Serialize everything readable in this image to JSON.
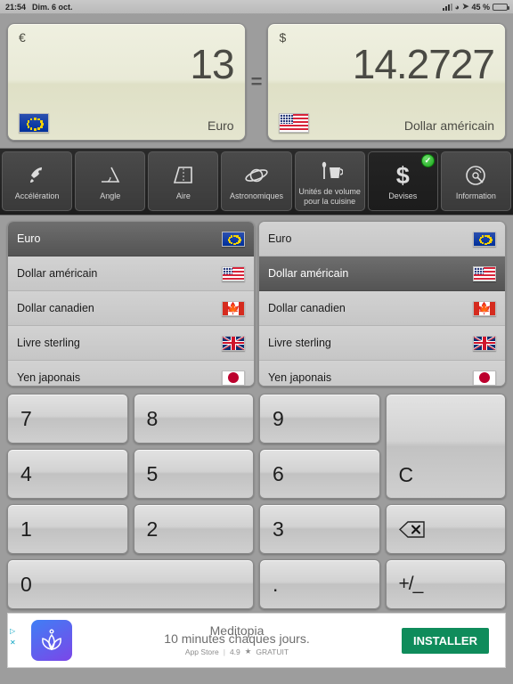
{
  "statusbar": {
    "time": "21:54",
    "date": "Dim. 6 oct.",
    "battery_percent": "45 %",
    "icons": [
      "signal-icon",
      "wifi-icon",
      "location-arrow-icon",
      "battery-icon"
    ]
  },
  "displays": {
    "left": {
      "symbol": "€",
      "value": "13",
      "currency_name": "Euro",
      "flag": "flag-eu"
    },
    "equals": "=",
    "right": {
      "symbol": "$",
      "value": "14.2727",
      "currency_name": "Dollar américain",
      "flag": "flag-us"
    }
  },
  "tabs": [
    {
      "label": "Accélération",
      "icon": "rocket-icon",
      "selected": false
    },
    {
      "label": "Angle",
      "icon": "angle-icon",
      "selected": false
    },
    {
      "label": "Aire",
      "icon": "area-icon",
      "selected": false
    },
    {
      "label": "Astronomiques",
      "icon": "planet-icon",
      "selected": false
    },
    {
      "label": "Unités de volume pour la cuisine",
      "icon": "cup-spoon-icon",
      "selected": false
    },
    {
      "label": "Devises",
      "icon": "dollar-icon",
      "selected": true,
      "badge": "✓"
    },
    {
      "label": "Information",
      "icon": "disc-icon",
      "selected": false
    }
  ],
  "currency_lists": {
    "left": {
      "selected_index": 0,
      "items": [
        {
          "name": "Euro",
          "flag": "flag-eu"
        },
        {
          "name": "Dollar américain",
          "flag": "flag-us"
        },
        {
          "name": "Dollar canadien",
          "flag": "flag-ca"
        },
        {
          "name": "Livre sterling",
          "flag": "flag-uk"
        },
        {
          "name": "Yen japonais",
          "flag": "flag-jp"
        }
      ]
    },
    "right": {
      "selected_index": 1,
      "items": [
        {
          "name": "Euro",
          "flag": "flag-eu"
        },
        {
          "name": "Dollar américain",
          "flag": "flag-us"
        },
        {
          "name": "Dollar canadien",
          "flag": "flag-ca"
        },
        {
          "name": "Livre sterling",
          "flag": "flag-uk"
        },
        {
          "name": "Yen japonais",
          "flag": "flag-jp"
        }
      ]
    }
  },
  "keypad": {
    "keys": [
      {
        "label": "7",
        "name": "key-7"
      },
      {
        "label": "8",
        "name": "key-8"
      },
      {
        "label": "9",
        "name": "key-9"
      },
      {
        "label": "C",
        "name": "key-clear"
      },
      {
        "label": "4",
        "name": "key-4"
      },
      {
        "label": "5",
        "name": "key-5"
      },
      {
        "label": "6",
        "name": "key-6"
      },
      {
        "label": "1",
        "name": "key-1"
      },
      {
        "label": "2",
        "name": "key-2"
      },
      {
        "label": "3",
        "name": "key-3"
      },
      {
        "label": "",
        "name": "key-backspace"
      },
      {
        "label": "0",
        "name": "key-0"
      },
      {
        "label": ".",
        "name": "key-decimal"
      },
      {
        "label": "+/_",
        "name": "key-plus-minus"
      }
    ]
  },
  "ad": {
    "title": "Meditopia",
    "subtitle": "10 minutes chaques jours.",
    "store": "App Store",
    "rating": "4.9",
    "star": "★",
    "price": "GRATUIT",
    "cta": "INSTALLER",
    "ad_marker": "▷",
    "close_marker": "✕"
  },
  "colors": {
    "accent_green": "#0f8c5b",
    "badge_green": "#17a417",
    "display_bg": "#e9ead7",
    "selection_gray": "#5c5c5c"
  }
}
